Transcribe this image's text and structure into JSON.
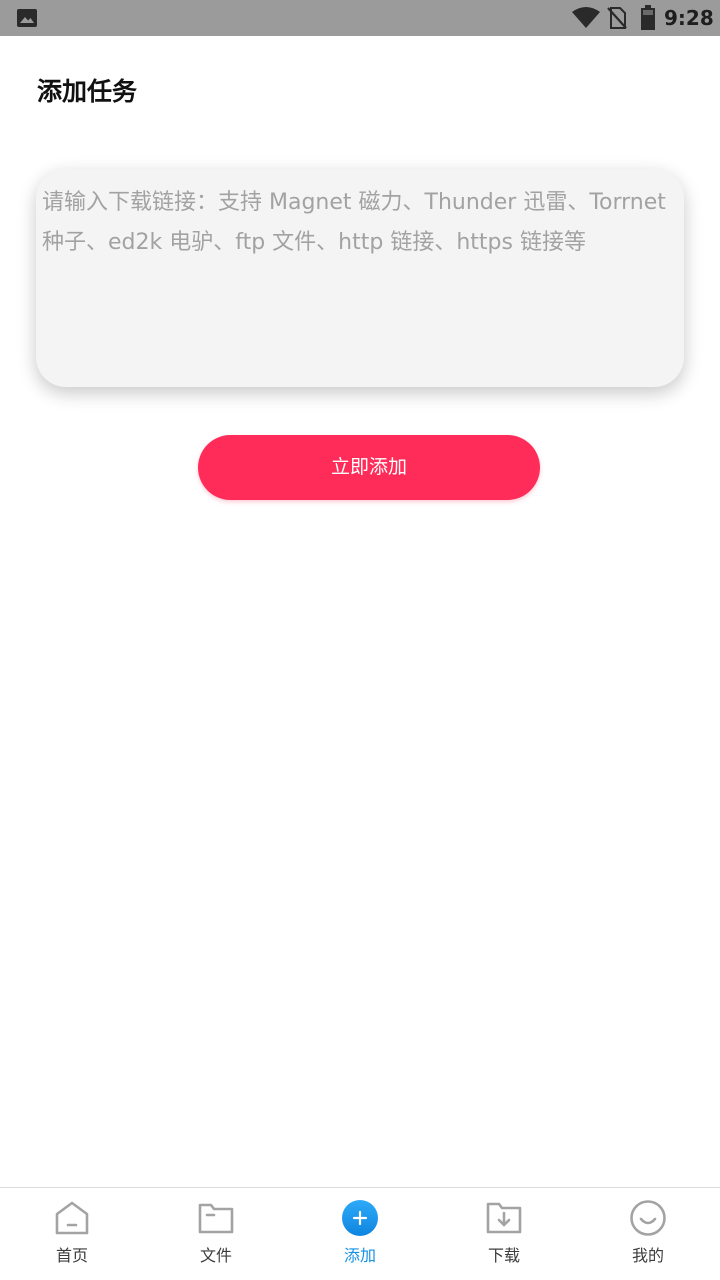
{
  "status_bar": {
    "time": "9:28",
    "icons": [
      "gallery-icon",
      "wifi-icon",
      "no-sim-icon",
      "battery-icon"
    ]
  },
  "page": {
    "title": "添加任务"
  },
  "input": {
    "value": "",
    "placeholder": "请输入下载链接：支持 Magnet 磁力、Thunder 迅雷、Torrnet 种子、ed2k 电驴、ftp 文件、http 链接、https 链接等"
  },
  "add_button": {
    "label": "立即添加",
    "color": "#ff2b58"
  },
  "bottom_nav": {
    "active_index": 2,
    "active_color": "#1592e6",
    "items": [
      {
        "label": "首页",
        "icon": "home-icon"
      },
      {
        "label": "文件",
        "icon": "folder-icon"
      },
      {
        "label": "添加",
        "icon": "add-circle-icon"
      },
      {
        "label": "下载",
        "icon": "download-folder-icon"
      },
      {
        "label": "我的",
        "icon": "smile-face-icon"
      }
    ]
  }
}
